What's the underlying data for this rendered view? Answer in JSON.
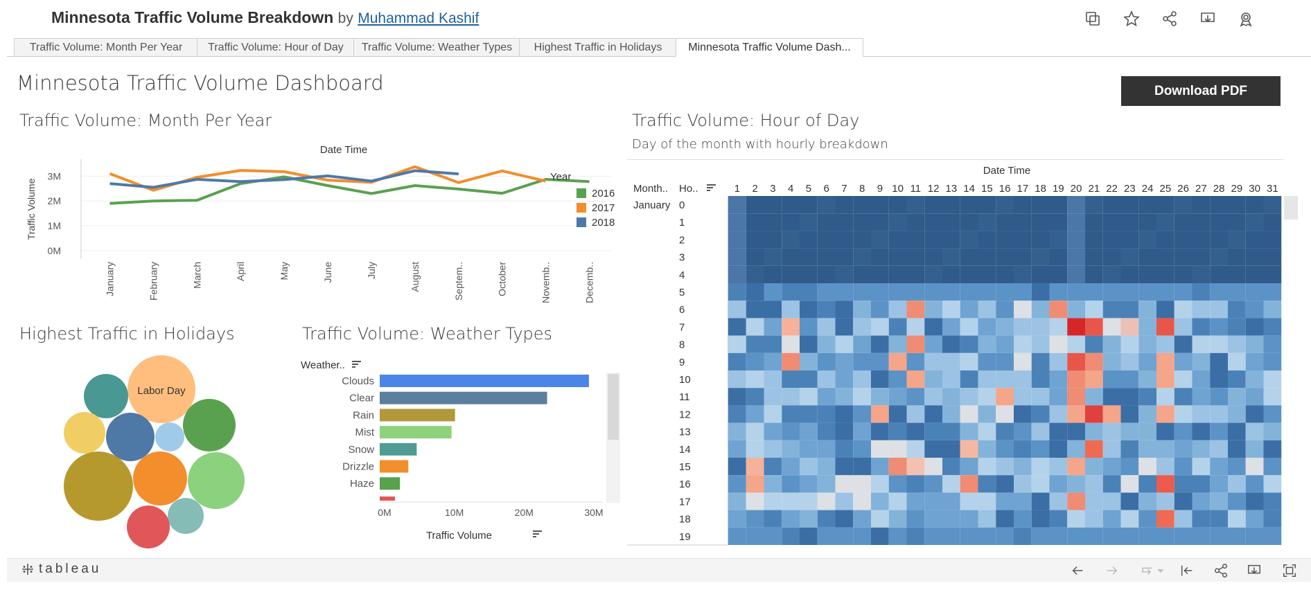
{
  "header": {
    "title": "Minnesota Traffic Volume Breakdown",
    "by": "by",
    "author": "Muhammad Kashif",
    "icons": [
      "copy-icon",
      "star-icon",
      "share-icon",
      "download-icon",
      "badge-icon"
    ]
  },
  "tabs": [
    {
      "label": "Traffic Volume: Month Per Year",
      "active": false
    },
    {
      "label": "Traffic Volume: Hour of Day",
      "active": false
    },
    {
      "label": "Traffic Volume: Weather Types",
      "active": false
    },
    {
      "label": "Highest Traffic in Holidays",
      "active": false
    },
    {
      "label": "Minnesota Traffic Volume Dash...",
      "active": true
    }
  ],
  "dashboard": {
    "title": "Minnesota Traffic Volume Dashboard",
    "download_label": "Download PDF"
  },
  "line_panel": {
    "title": "Traffic Volume: Month Per Year",
    "x_header": "Date Time",
    "legend_title": "Year"
  },
  "holiday_panel": {
    "title": "Highest Traffic in Holidays",
    "bubble_label": "Labor Day"
  },
  "weather_panel": {
    "title": "Traffic Volume: Weather Types",
    "header": "Weather..",
    "x_title": "Traffic Volume"
  },
  "heatmap_panel": {
    "title": "Traffic Volume: Hour of Day",
    "subtitle": "Day of the month with hourly breakdown",
    "x_header": "Date Time",
    "col_month": "Month..",
    "col_hour": "Ho..",
    "month_label": "January"
  },
  "footer": {
    "logo": "tableau",
    "icons": [
      "undo-icon",
      "redo-icon",
      "revert-icon",
      "reset-icon",
      "share-icon",
      "download-icon",
      "fullscreen-icon"
    ]
  },
  "chart_data": [
    {
      "type": "line",
      "title": "Traffic Volume: Month Per Year",
      "xlabel": "Date Time",
      "ylabel": "Traffic Volume",
      "categories": [
        "January",
        "February",
        "March",
        "April",
        "May",
        "June",
        "July",
        "August",
        "Septem..",
        "October",
        "Novemb..",
        "Decemb.."
      ],
      "y_ticks": [
        "0M",
        "1M",
        "2M",
        "3M"
      ],
      "ylim": [
        0,
        3400000
      ],
      "legend_title": "Year",
      "legend_visible": [
        "2016",
        "2017",
        "2018"
      ],
      "series": [
        {
          "name": "2016",
          "color": "#59a14f",
          "values": [
            1900000,
            2000000,
            2030000,
            2700000,
            2970000,
            2620000,
            2300000,
            2620000,
            2480000,
            2310000,
            2870000,
            2780000
          ]
        },
        {
          "name": "2017",
          "color": "#f28e2b",
          "values": [
            3100000,
            2430000,
            2950000,
            3230000,
            3180000,
            2840000,
            2750000,
            3380000,
            2740000,
            3210000,
            2800000,
            null
          ]
        },
        {
          "name": "2018",
          "color": "#4e79a7",
          "values": [
            2700000,
            2550000,
            2870000,
            2780000,
            2860000,
            3010000,
            2800000,
            3220000,
            3090000,
            null,
            null,
            null
          ]
        }
      ]
    },
    {
      "type": "bar",
      "title": "Traffic Volume: Weather Types",
      "orientation": "horizontal",
      "xlabel": "Traffic Volume",
      "categories": [
        "Clouds",
        "Clear",
        "Rain",
        "Mist",
        "Snow",
        "Drizzle",
        "Haze"
      ],
      "values": [
        30000000,
        24000000,
        10800000,
        10300000,
        5300000,
        4100000,
        2900000
      ],
      "colors": [
        "#4a86e8",
        "#5b7f9e",
        "#b0993a",
        "#8ed27b",
        "#4f9c94",
        "#f28e2b",
        "#59a14f"
      ],
      "x_ticks": [
        "0M",
        "10M",
        "20M",
        "30M"
      ],
      "xlim": [
        0,
        31000000
      ]
    },
    {
      "type": "heatmap",
      "title": "Traffic Volume: Hour of Day",
      "subtitle": "Day of the month with hourly breakdown",
      "xlabel": "Date Time",
      "days": [
        1,
        2,
        3,
        4,
        5,
        6,
        7,
        8,
        9,
        10,
        11,
        12,
        13,
        14,
        15,
        16,
        17,
        18,
        19,
        20,
        21,
        22,
        23,
        24,
        25,
        26,
        27,
        28,
        29,
        30,
        31
      ],
      "hours": [
        0,
        1,
        2,
        3,
        4,
        5,
        6,
        7,
        8,
        9,
        10,
        11,
        12,
        13,
        14,
        15,
        16,
        17,
        18,
        19
      ],
      "month": "January"
    },
    {
      "type": "bubble",
      "title": "Highest Traffic in Holidays",
      "labels": [
        "Labor Day"
      ]
    }
  ]
}
